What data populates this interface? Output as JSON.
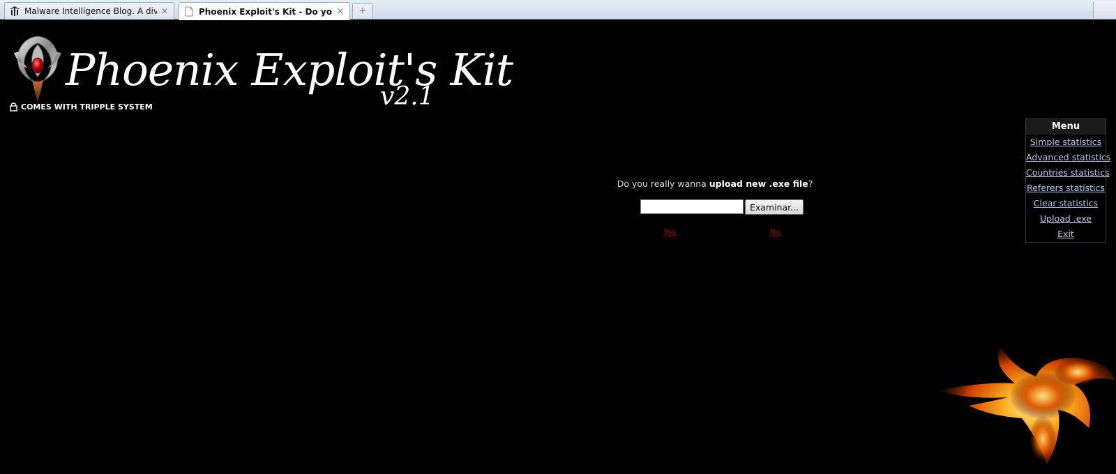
{
  "browser": {
    "tabs": [
      {
        "title": "Malware Intelligence Blog. A divisio...",
        "active": false,
        "icon": "malware-blog-favicon"
      },
      {
        "title": "Phoenix Exploit's Kit - Do you rea...",
        "active": true,
        "icon": "page-icon"
      }
    ],
    "close_glyph": "×",
    "new_tab_glyph": "+"
  },
  "logo": {
    "title": "Phoenix Exploit's Kit",
    "version": "v2.1",
    "tagline": "COMES WITH TRIPPLE SYSTEM"
  },
  "upload": {
    "prompt_prefix": "Do you really wanna ",
    "prompt_bold": "upload new .exe file",
    "prompt_suffix": "?",
    "file_value": "",
    "browse_label": "Examinar...",
    "yes_label": "Yes",
    "no_label": "No"
  },
  "menu": {
    "title": "Menu",
    "items": [
      "Simple statistics",
      "Advanced statistics",
      "Countries statistics",
      "Referers statistics",
      "Clear statistics",
      "Upload .exe",
      "Exit"
    ]
  },
  "colors": {
    "background": "#000000",
    "link": "#b8c8e6",
    "danger_link": "#9a0000"
  }
}
